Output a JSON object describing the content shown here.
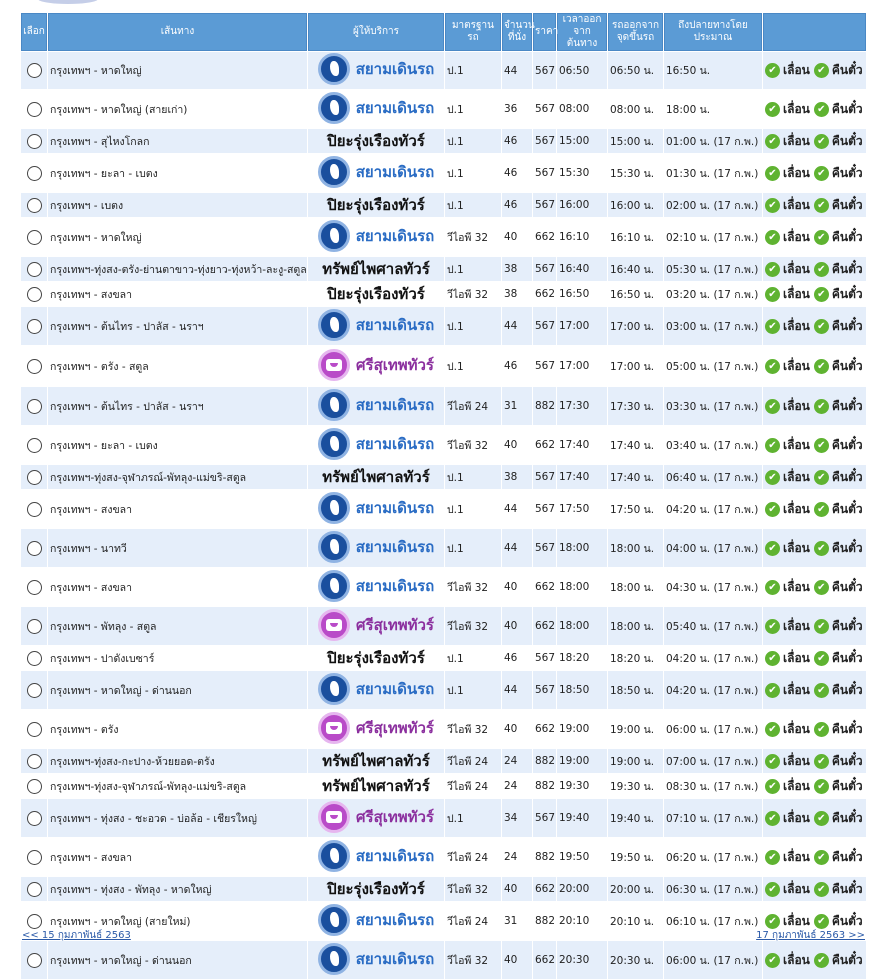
{
  "headers": {
    "select": "เลือก",
    "route": "เส้นทาง",
    "provider": "ผู้ให้บริการ",
    "standard": "มาตรฐานรถ",
    "seats": "จำนวนที่นั่ง",
    "price": "ราคา",
    "depart": "เวลาออกจากต้นทาง",
    "pickup": "รถออกจากจุดขึ้นรถ",
    "arrive": "ถึงปลายทางโดยประมาณ",
    "actions": ""
  },
  "actions": {
    "move": "เลื่อน",
    "refund": "คืนตั๋ว"
  },
  "providers": {
    "siam": "สยามเดินรถ",
    "piya": "ปิยะรุ่งเรืองทัวร์",
    "sap": "ทรัพย์ไพศาลทัวร์",
    "sri": "ศรีสุเทพทัวร์"
  },
  "rows": [
    {
      "route": "กรุงเทพฯ - หาดใหญ่",
      "provider": "siam",
      "std": "ป.1",
      "seats": "44",
      "price": "567",
      "depart": "06:50",
      "pickup": "06:50 น.",
      "arrive": "16:50 น."
    },
    {
      "route": "กรุงเทพฯ - หาดใหญ่ (สายเก่า)",
      "provider": "siam",
      "std": "ป.1",
      "seats": "36",
      "price": "567",
      "depart": "08:00",
      "pickup": "08:00 น.",
      "arrive": "18:00 น."
    },
    {
      "route": "กรุงเทพฯ - สุไหงโกลก",
      "provider": "piya",
      "std": "ป.1",
      "seats": "46",
      "price": "567",
      "depart": "15:00",
      "pickup": "15:00 น.",
      "arrive": "01:00 น. (17 ก.พ.)"
    },
    {
      "route": "กรุงเทพฯ - ยะลา - เบตง",
      "provider": "siam",
      "std": "ป.1",
      "seats": "46",
      "price": "567",
      "depart": "15:30",
      "pickup": "15:30 น.",
      "arrive": "01:30 น. (17 ก.พ.)"
    },
    {
      "route": "กรุงเทพฯ - เบตง",
      "provider": "piya",
      "std": "ป.1",
      "seats": "46",
      "price": "567",
      "depart": "16:00",
      "pickup": "16:00 น.",
      "arrive": "02:00 น. (17 ก.พ.)"
    },
    {
      "route": "กรุงเทพฯ - หาดใหญ่",
      "provider": "siam",
      "std": "วีไอพี 32",
      "seats": "40",
      "price": "662",
      "depart": "16:10",
      "pickup": "16:10 น.",
      "arrive": "02:10 น. (17 ก.พ.)"
    },
    {
      "route": "กรุงเทพฯ-ทุ่งสง-ตรัง-ย่านตาขาว-ทุ่งยาว-ทุ่งหว้า-ละงู-สตูล",
      "provider": "sap",
      "std": "ป.1",
      "seats": "38",
      "price": "567",
      "depart": "16:40",
      "pickup": "16:40 น.",
      "arrive": "05:30 น. (17 ก.พ.)"
    },
    {
      "route": "กรุงเทพฯ - สงขลา",
      "provider": "piya",
      "std": "วีไอพี 32",
      "seats": "38",
      "price": "662",
      "depart": "16:50",
      "pickup": "16:50 น.",
      "arrive": "03:20 น. (17 ก.พ.)"
    },
    {
      "route": "กรุงเทพฯ - ต้นไทร - ปาลัส - นราฯ",
      "provider": "siam",
      "std": "ป.1",
      "seats": "44",
      "price": "567",
      "depart": "17:00",
      "pickup": "17:00 น.",
      "arrive": "03:00 น. (17 ก.พ.)"
    },
    {
      "route": "กรุงเทพฯ - ตรัง - สตูล",
      "provider": "sri",
      "std": "ป.1",
      "seats": "46",
      "price": "567",
      "depart": "17:00",
      "pickup": "17:00 น.",
      "arrive": "05:00 น. (17 ก.พ.)"
    },
    {
      "route": "กรุงเทพฯ - ต้นไทร - ปาลัส - นราฯ",
      "provider": "siam",
      "std": "วีไอพี 24",
      "seats": "31",
      "price": "882",
      "depart": "17:30",
      "pickup": "17:30 น.",
      "arrive": "03:30 น. (17 ก.พ.)"
    },
    {
      "route": "กรุงเทพฯ - ยะลา - เบตง",
      "provider": "siam",
      "std": "วีไอพี 32",
      "seats": "40",
      "price": "662",
      "depart": "17:40",
      "pickup": "17:40 น.",
      "arrive": "03:40 น. (17 ก.พ.)"
    },
    {
      "route": "กรุงเทพฯ-ทุ่งสง-จุฬาภรณ์-พัทลุง-แม่ขริ-สตูล",
      "provider": "sap",
      "std": "ป.1",
      "seats": "38",
      "price": "567",
      "depart": "17:40",
      "pickup": "17:40 น.",
      "arrive": "06:40 น. (17 ก.พ.)"
    },
    {
      "route": "กรุงเทพฯ - สงขลา",
      "provider": "siam",
      "std": "ป.1",
      "seats": "44",
      "price": "567",
      "depart": "17:50",
      "pickup": "17:50 น.",
      "arrive": "04:20 น. (17 ก.พ.)"
    },
    {
      "route": "กรุงเทพฯ - นาทวี",
      "provider": "siam",
      "std": "ป.1",
      "seats": "44",
      "price": "567",
      "depart": "18:00",
      "pickup": "18:00 น.",
      "arrive": "04:00 น. (17 ก.พ.)"
    },
    {
      "route": "กรุงเทพฯ - สงขลา",
      "provider": "siam",
      "std": "วีไอพี 32",
      "seats": "40",
      "price": "662",
      "depart": "18:00",
      "pickup": "18:00 น.",
      "arrive": "04:30 น. (17 ก.พ.)"
    },
    {
      "route": "กรุงเทพฯ - พัทลุง - สตูล",
      "provider": "sri",
      "std": "วีไอพี 32",
      "seats": "40",
      "price": "662",
      "depart": "18:00",
      "pickup": "18:00 น.",
      "arrive": "05:40 น. (17 ก.พ.)"
    },
    {
      "route": "กรุงเทพฯ - ปาดังเบซาร์",
      "provider": "piya",
      "std": "ป.1",
      "seats": "46",
      "price": "567",
      "depart": "18:20",
      "pickup": "18:20 น.",
      "arrive": "04:20 น. (17 ก.พ.)"
    },
    {
      "route": "กรุงเทพฯ - หาดใหญ่ - ด่านนอก",
      "provider": "siam",
      "std": "ป.1",
      "seats": "44",
      "price": "567",
      "depart": "18:50",
      "pickup": "18:50 น.",
      "arrive": "04:20 น. (17 ก.พ.)"
    },
    {
      "route": "กรุงเทพฯ - ตรัง",
      "provider": "sri",
      "std": "วีไอพี 32",
      "seats": "40",
      "price": "662",
      "depart": "19:00",
      "pickup": "19:00 น.",
      "arrive": "06:00 น. (17 ก.พ.)"
    },
    {
      "route": "กรุงเทพฯ-ทุ่งสง-กะปาง-ห้วยยอด-ตรัง",
      "provider": "sap",
      "std": "วีไอพี 24",
      "seats": "24",
      "price": "882",
      "depart": "19:00",
      "pickup": "19:00 น.",
      "arrive": "07:00 น. (17 ก.พ.)"
    },
    {
      "route": "กรุงเทพฯ-ทุ่งสง-จุฬาภรณ์-พัทลุง-แม่ขริ-สตูล",
      "provider": "sap",
      "std": "วีไอพี 24",
      "seats": "24",
      "price": "882",
      "depart": "19:30",
      "pickup": "19:30 น.",
      "arrive": "08:30 น. (17 ก.พ.)"
    },
    {
      "route": "กรุงเทพฯ - ทุ่งสง - ชะอวด - บ่อล้อ - เชียรใหญ่",
      "provider": "sri",
      "std": "ป.1",
      "seats": "34",
      "price": "567",
      "depart": "19:40",
      "pickup": "19:40 น.",
      "arrive": "07:10 น. (17 ก.พ.)"
    },
    {
      "route": "กรุงเทพฯ - สงขลา",
      "provider": "siam",
      "std": "วีไอพี 24",
      "seats": "24",
      "price": "882",
      "depart": "19:50",
      "pickup": "19:50 น.",
      "arrive": "06:20 น. (17 ก.พ.)"
    },
    {
      "route": "กรุงเทพฯ - ทุ่งสง - พัทลุง - หาดใหญ่",
      "provider": "piya",
      "std": "วีไอพี 32",
      "seats": "40",
      "price": "662",
      "depart": "20:00",
      "pickup": "20:00 น.",
      "arrive": "06:30 น. (17 ก.พ.)"
    },
    {
      "route": "กรุงเทพฯ - หาดใหญ่ (สายใหม่)",
      "provider": "siam",
      "std": "วีไอพี 24",
      "seats": "31",
      "price": "882",
      "depart": "20:10",
      "pickup": "20:10 น.",
      "arrive": "06:10 น. (17 ก.พ.)"
    },
    {
      "route": "กรุงเทพฯ - หาดใหญ่ - ด่านนอก",
      "provider": "siam",
      "std": "วีไอพี 32",
      "seats": "40",
      "price": "662",
      "depart": "20:30",
      "pickup": "20:30 น.",
      "arrive": "06:00 น. (17 ก.พ.)"
    }
  ],
  "footer": {
    "prev": "<< 15 กุมภาพันธ์ 2563",
    "next": "17 กุมภาพันธ์ 2563 >>"
  }
}
